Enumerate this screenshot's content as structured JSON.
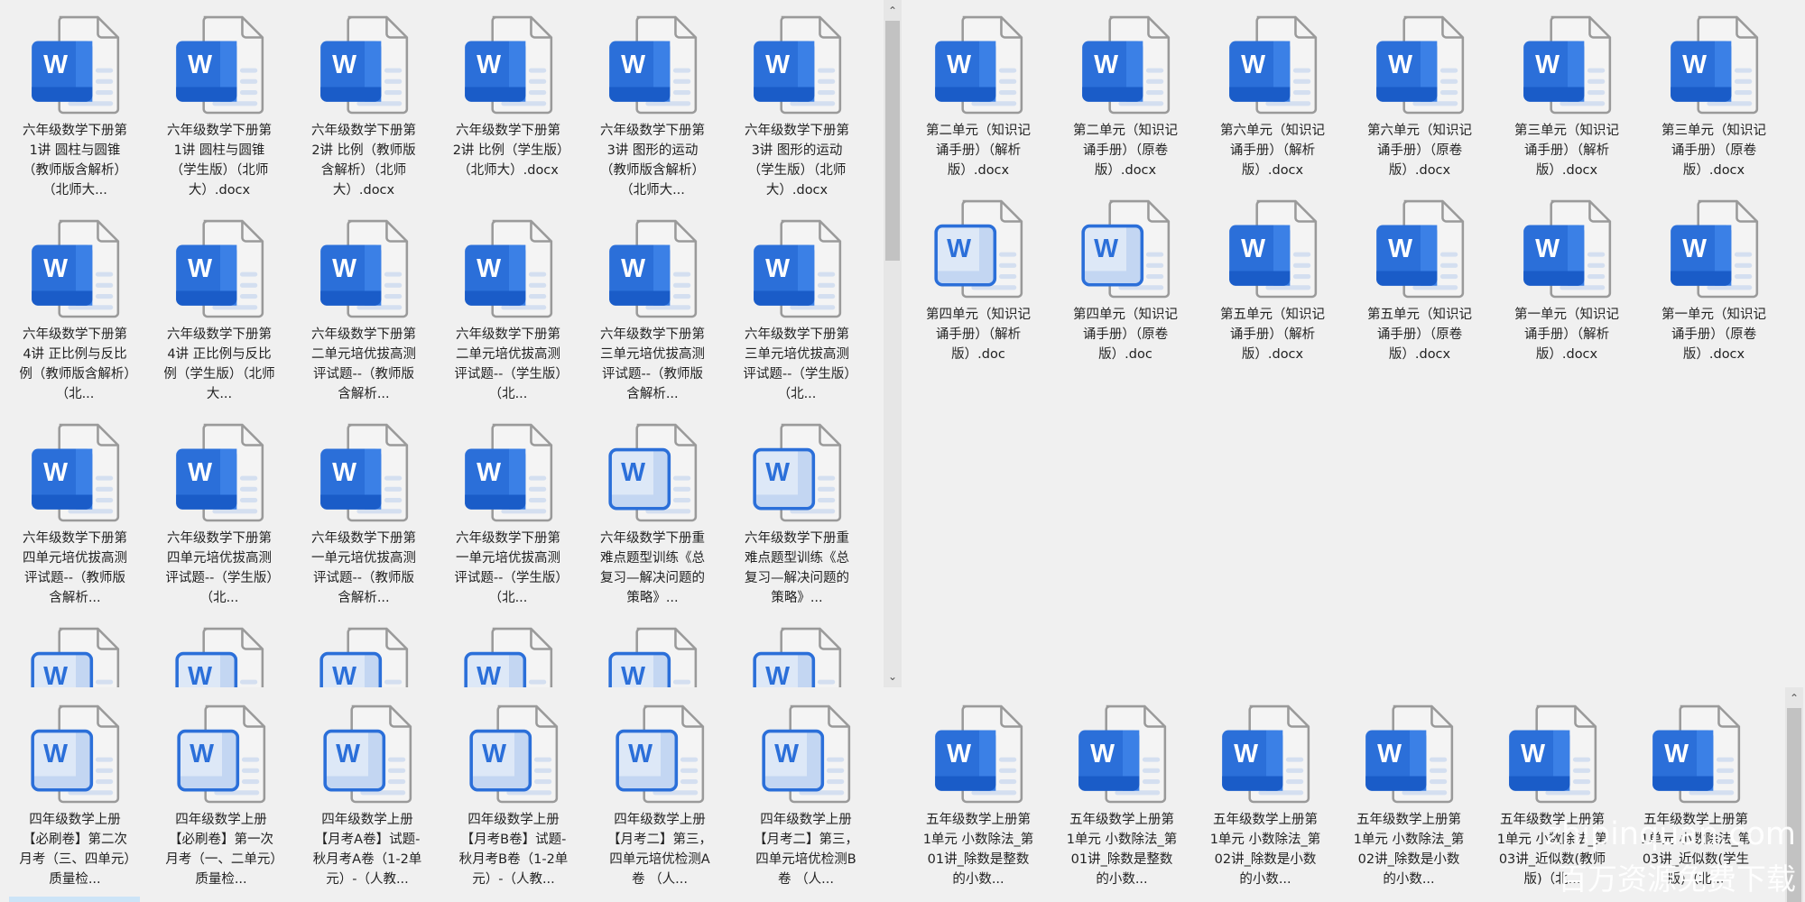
{
  "colors": {
    "accent": "#2b6fd9",
    "accent_dark": "#1a5cc8",
    "outline_fill": "#dde8f7",
    "doc_stroke": "#9a9a9a"
  },
  "icon_glyph": "W",
  "panels": {
    "top_left": {
      "items": [
        {
          "icon": "solid",
          "label": "六年级数学下册第1讲 圆柱与圆锥（教师版含解析）（北师大..."
        },
        {
          "icon": "solid",
          "label": "六年级数学下册第1讲 圆柱与圆锥（学生版）（北师大）.docx"
        },
        {
          "icon": "solid",
          "label": "六年级数学下册第2讲 比例（教师版含解析）（北师大）.docx"
        },
        {
          "icon": "solid",
          "label": "六年级数学下册第2讲 比例（学生版）（北师大）.docx"
        },
        {
          "icon": "solid",
          "label": "六年级数学下册第3讲 图形的运动（教师版含解析）（北师大..."
        },
        {
          "icon": "solid",
          "label": "六年级数学下册第3讲 图形的运动（学生版）（北师大）.docx"
        },
        {
          "icon": "solid",
          "label": "六年级数学下册第4讲 正比例与反比例（教师版含解析）（北..."
        },
        {
          "icon": "solid",
          "label": "六年级数学下册第4讲 正比例与反比例（学生版）（北师大..."
        },
        {
          "icon": "solid",
          "label": "六年级数学下册第二单元培优拔高测评试题--（教师版含解析..."
        },
        {
          "icon": "solid",
          "label": "六年级数学下册第二单元培优拔高测评试题--（学生版）（北..."
        },
        {
          "icon": "solid",
          "label": "六年级数学下册第三单元培优拔高测评试题--（教师版含解析..."
        },
        {
          "icon": "solid",
          "label": "六年级数学下册第三单元培优拔高测评试题--（学生版）（北..."
        },
        {
          "icon": "solid",
          "label": "六年级数学下册第四单元培优拔高测评试题--（教师版含解析..."
        },
        {
          "icon": "solid",
          "label": "六年级数学下册第四单元培优拔高测评试题--（学生版）（北..."
        },
        {
          "icon": "solid",
          "label": "六年级数学下册第一单元培优拔高测评试题--（教师版含解析..."
        },
        {
          "icon": "solid",
          "label": "六年级数学下册第一单元培优拔高测评试题--（学生版）（北..."
        },
        {
          "icon": "outline",
          "label": "六年级数学下册重难点题型训练《总复习—解决问题的策略》..."
        },
        {
          "icon": "outline",
          "label": "六年级数学下册重难点题型训练《总复习—解决问题的策略》..."
        },
        {
          "icon": "outline"
        },
        {
          "icon": "outline"
        },
        {
          "icon": "outline"
        },
        {
          "icon": "outline"
        },
        {
          "icon": "outline"
        },
        {
          "icon": "outline"
        }
      ]
    },
    "top_right": {
      "items": [
        {
          "icon": "solid",
          "label": "第二单元（知识记诵手册）（解析版）.docx"
        },
        {
          "icon": "solid",
          "label": "第二单元（知识记诵手册）（原卷版）.docx"
        },
        {
          "icon": "solid",
          "label": "第六单元（知识记诵手册）（解析版）.docx"
        },
        {
          "icon": "solid",
          "label": "第六单元（知识记诵手册）（原卷版）.docx"
        },
        {
          "icon": "solid",
          "label": "第三单元（知识记诵手册）（解析版）.docx"
        },
        {
          "icon": "solid",
          "label": "第三单元（知识记诵手册）（原卷版）.docx"
        },
        {
          "icon": "outline",
          "label": "第四单元（知识记诵手册）（解析版）.doc"
        },
        {
          "icon": "outline",
          "label": "第四单元（知识记诵手册）（原卷版）.doc"
        },
        {
          "icon": "solid",
          "label": "第五单元（知识记诵手册）（解析版）.docx"
        },
        {
          "icon": "solid",
          "label": "第五单元（知识记诵手册）（原卷版）.docx"
        },
        {
          "icon": "solid",
          "label": "第一单元（知识记诵手册）（解析版）.docx"
        },
        {
          "icon": "solid",
          "label": "第一单元（知识记诵手册）（原卷版）.docx"
        }
      ]
    },
    "bottom_left": {
      "items": [
        {
          "icon": "outline",
          "label": "四年级数学上册【必刷卷】第二次月考（三、四单元）质量检..."
        },
        {
          "icon": "outline",
          "label": "四年级数学上册【必刷卷】第一次月考（一、二单元）质量检..."
        },
        {
          "icon": "outline",
          "label": "四年级数学上册【月考A卷】试题-秋月考A卷（1-2单元）-（人教..."
        },
        {
          "icon": "outline",
          "label": "四年级数学上册【月考B卷】试题-秋月考B卷（1-2单元）-（人教..."
        },
        {
          "icon": "outline",
          "label": "四年级数学上册【月考二】第三，四单元培优检测A卷 （人..."
        },
        {
          "icon": "outline",
          "label": "四年级数学上册【月考二】第三，四单元培优检测B卷 （人..."
        }
      ]
    },
    "bottom_right": {
      "items": [
        {
          "icon": "solid",
          "label": "五年级数学上册第1单元 小数除法_第01讲_除数是整数的小数..."
        },
        {
          "icon": "solid",
          "label": "五年级数学上册第1单元 小数除法_第01讲_除数是整数的小数..."
        },
        {
          "icon": "solid",
          "label": "五年级数学上册第1单元 小数除法_第02讲_除数是小数的小数..."
        },
        {
          "icon": "solid",
          "label": "五年级数学上册第1单元 小数除法_第02讲_除数是小数的小数..."
        },
        {
          "icon": "solid",
          "label": "五年级数学上册第1单元 小数除法_第03讲_近似数(教师版)（北..."
        },
        {
          "icon": "solid",
          "label": "五年级数学上册第1单元 小数除法_第03讲_近似数(学生版)（北..."
        }
      ]
    }
  },
  "scrollbar": {
    "up": "⌃",
    "down": "⌄"
  },
  "watermark": {
    "line1": "zhipinquan.com",
    "line2": "百万资源免费下载"
  }
}
